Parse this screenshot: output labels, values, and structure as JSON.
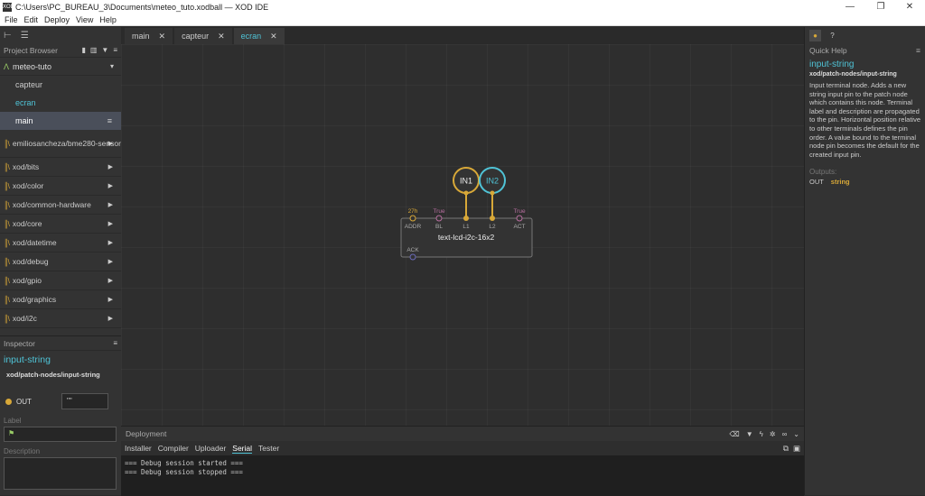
{
  "window": {
    "title": "C:\\Users\\PC_BUREAU_3\\Documents\\meteo_tuto.xodball — XOD IDE",
    "app_icon": "XOD"
  },
  "menu": [
    "File",
    "Edit",
    "Deploy",
    "View",
    "Help"
  ],
  "project_browser": {
    "header": "Project Browser",
    "project_name": "meteo-tuto",
    "patches": [
      "capteur",
      "ecran",
      "main"
    ],
    "libraries": [
      "emiliosancheza/bme280-sensor",
      "xod/bits",
      "xod/color",
      "xod/common-hardware",
      "xod/core",
      "xod/datetime",
      "xod/debug",
      "xod/gpio",
      "xod/graphics",
      "xod/i2c"
    ]
  },
  "inspector": {
    "header": "Inspector",
    "node_title": "input-string",
    "node_path": "xod/patch-nodes/input-string",
    "pin_label": "OUT",
    "pin_value": "\"\"",
    "label_field": "Label",
    "description_field": "Description"
  },
  "tabs": [
    {
      "label": "main"
    },
    {
      "label": "capteur"
    },
    {
      "label": "ecran"
    }
  ],
  "canvas": {
    "node": {
      "title": "text-lcd-i2c-16x2",
      "pins_top": [
        {
          "label": "ADDR",
          "value": "27h"
        },
        {
          "label": "BL",
          "value": "True"
        },
        {
          "label": "L1",
          "value": ""
        },
        {
          "label": "L2",
          "value": ""
        },
        {
          "label": "ACT",
          "value": "True"
        }
      ],
      "pins_bottom": [
        {
          "label": "ACK"
        }
      ]
    },
    "terminals": [
      "IN1",
      "IN2"
    ]
  },
  "deployment": {
    "header": "Deployment",
    "tabs": [
      "Installer",
      "Compiler",
      "Uploader",
      "Serial",
      "Tester"
    ],
    "active_tab": "Serial",
    "console_lines": [
      "=== Debug session started ===",
      "=== Debug session stopped ==="
    ]
  },
  "quick_help": {
    "header": "Quick Help",
    "title": "input-string",
    "path": "xod/patch-nodes/input-string",
    "description": "Input terminal node. Adds a new string input pin to the patch node which contains this node. Terminal label and description are propagated to the pin. Horizontal position relative to other terminals defines the pin order. A value bound to the terminal node pin becomes the default for the created input pin.",
    "outputs_label": "Outputs:",
    "output_pin": "OUT",
    "output_type": "string"
  },
  "colors": {
    "accent": "#4fc3d6",
    "string_pin": "#d8a838",
    "boolean_pin": "#b86fa0",
    "pulse_pin": "#6a6ab8",
    "background": "#2e2e2e"
  }
}
